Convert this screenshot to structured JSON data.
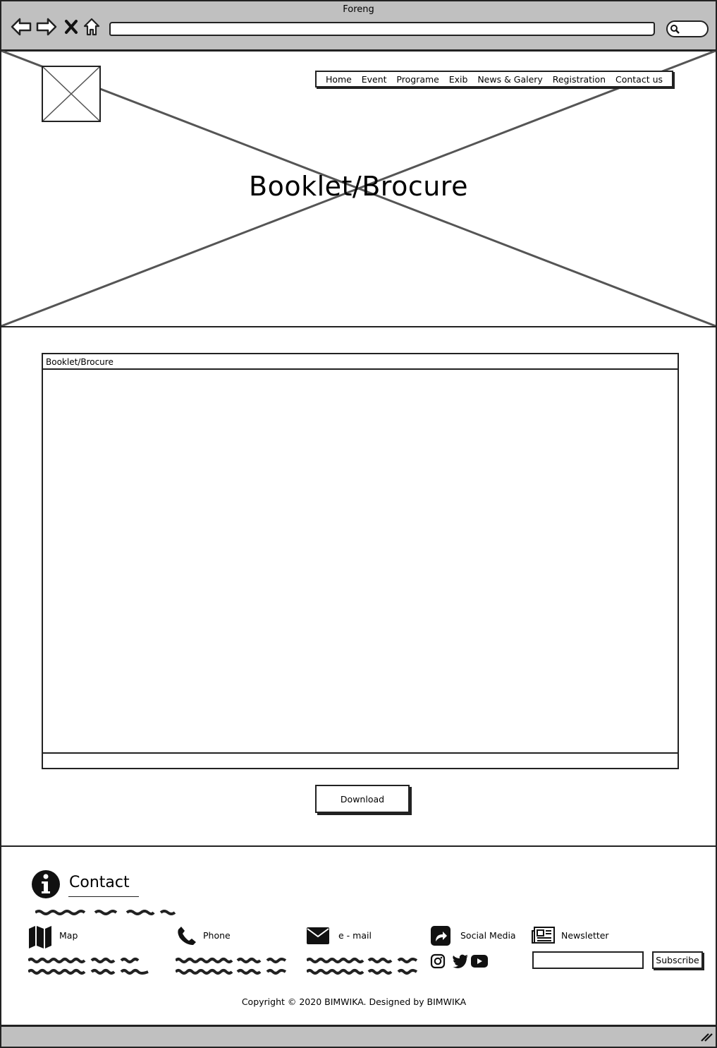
{
  "window": {
    "title": "Foreng"
  },
  "toolbar": {
    "back_icon": "back-arrow-icon",
    "forward_icon": "forward-arrow-icon",
    "stop_icon": "close-icon",
    "home_icon": "home-icon",
    "address_value": "",
    "search_icon": "search-icon"
  },
  "nav": {
    "items": [
      {
        "label": "Home"
      },
      {
        "label": "Event"
      },
      {
        "label": "Programe"
      },
      {
        "label": "Exib"
      },
      {
        "label": "News & Galery"
      },
      {
        "label": "Registration"
      },
      {
        "label": "Contact us"
      }
    ]
  },
  "hero": {
    "title": "Booklet/Brocure"
  },
  "viewer": {
    "title": "Booklet/Brocure"
  },
  "actions": {
    "download_label": "Download"
  },
  "footer": {
    "contact_title": "Contact",
    "columns": [
      {
        "label": "Map",
        "icon": "map-icon"
      },
      {
        "label": "Phone",
        "icon": "phone-icon"
      },
      {
        "label": "e - mail",
        "icon": "envelope-icon"
      },
      {
        "label": "Social Media",
        "icon": "share-icon"
      },
      {
        "label": "Newsletter",
        "icon": "newspaper-icon"
      }
    ],
    "social_icons": [
      "instagram-icon",
      "twitter-icon",
      "youtube-icon"
    ],
    "subscribe_value": "",
    "subscribe_label": "Subscribe",
    "copyright": "Copyright © 2020 BIMWIKA. Designed by BIMWIKA"
  }
}
